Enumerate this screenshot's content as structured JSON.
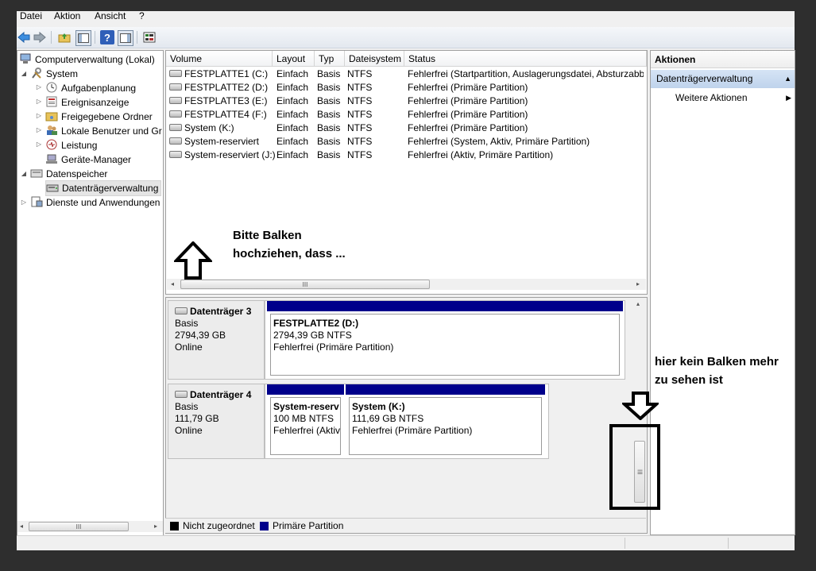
{
  "menu": [
    "Datei",
    "Aktion",
    "Ansicht",
    "?"
  ],
  "toolbar": {
    "icons": [
      "back-icon",
      "forward-icon",
      "up-folder-icon",
      "show-hide-tree-icon",
      "help-icon",
      "show-hide-action-pane-icon",
      "properties-icon"
    ]
  },
  "tree": {
    "root": "Computerverwaltung (Lokal)",
    "system": "System",
    "aufgabenplanung": "Aufgabenplanung",
    "ereignisanzeige": "Ereignisanzeige",
    "freigegebene_ordner": "Freigegebene Ordner",
    "lokale_benutzer": "Lokale Benutzer und Gr",
    "leistung": "Leistung",
    "geraete_manager": "Geräte-Manager",
    "datenspeicher": "Datenspeicher",
    "datentraegerverwaltung": "Datenträgerverwaltung",
    "dienste": "Dienste und Anwendungen",
    "scroll_grip": "III"
  },
  "volumes": {
    "headers": [
      "Volume",
      "Layout",
      "Typ",
      "Dateisystem",
      "Status"
    ],
    "rows": [
      [
        "FESTPLATTE1 (C:)",
        "Einfach",
        "Basis",
        "NTFS",
        "Fehlerfrei (Startpartition, Auslagerungsdatei, Absturzabbi"
      ],
      [
        "FESTPLATTE2 (D:)",
        "Einfach",
        "Basis",
        "NTFS",
        "Fehlerfrei (Primäre Partition)"
      ],
      [
        "FESTPLATTE3 (E:)",
        "Einfach",
        "Basis",
        "NTFS",
        "Fehlerfrei (Primäre Partition)"
      ],
      [
        "FESTPLATTE4 (F:)",
        "Einfach",
        "Basis",
        "NTFS",
        "Fehlerfrei (Primäre Partition)"
      ],
      [
        "System (K:)",
        "Einfach",
        "Basis",
        "NTFS",
        "Fehlerfrei (Primäre Partition)"
      ],
      [
        "System-reserviert",
        "Einfach",
        "Basis",
        "NTFS",
        "Fehlerfrei (System, Aktiv, Primäre Partition)"
      ],
      [
        "System-reserviert (J:)",
        "Einfach",
        "Basis",
        "NTFS",
        "Fehlerfrei (Aktiv, Primäre Partition)"
      ]
    ],
    "scroll_grip": "III"
  },
  "disks": [
    {
      "name": "Datenträger 3",
      "type": "Basis",
      "size": "2794,39 GB",
      "state": "Online",
      "partitions": [
        {
          "title": "FESTPLATTE2  (D:)",
          "size": "2794,39 GB NTFS",
          "status": "Fehlerfrei (Primäre Partition)"
        }
      ]
    },
    {
      "name": "Datenträger 4",
      "type": "Basis",
      "size": "111,79 GB",
      "state": "Online",
      "partitions": [
        {
          "title": "System-reserv",
          "size": "100 MB NTFS",
          "status": "Fehlerfrei (Aktiv"
        },
        {
          "title": "System  (K:)",
          "size": "111,69 GB NTFS",
          "status": "Fehlerfrei (Primäre Partition)"
        }
      ]
    }
  ],
  "graph_scroll_grip": "III",
  "legend": {
    "unallocated": "Nicht zugeordnet",
    "primary": "Primäre Partition",
    "unallocated_color": "#000000",
    "primary_color": "#00008b"
  },
  "actions": {
    "title": "Aktionen",
    "section": "Datenträgerverwaltung",
    "more": "Weitere Aktionen"
  },
  "annotations": {
    "top_line1": "Bitte Balken",
    "top_line2": "hochziehen, dass ...",
    "right_line1": "hier kein Balken mehr",
    "right_line2": "zu sehen ist"
  },
  "colors": {
    "accent_header": "#c5d9f1",
    "primary_partition": "#00008b"
  }
}
